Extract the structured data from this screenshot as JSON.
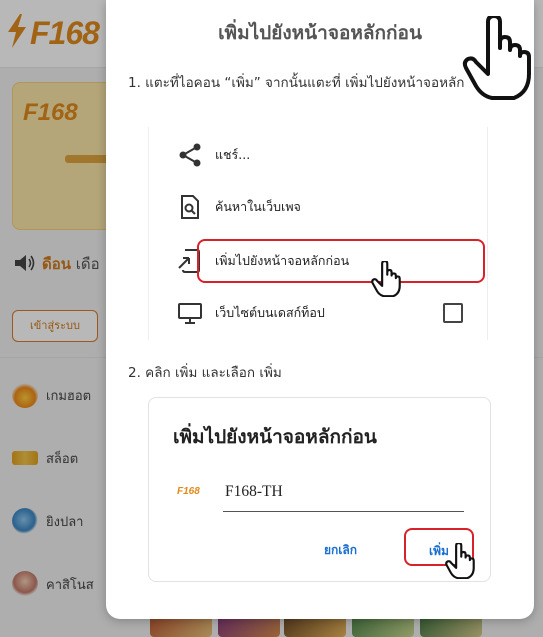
{
  "background": {
    "logo_text": "F168",
    "banner_logo_text": "F168",
    "news_label": "ดือน",
    "news_text": "เดือ",
    "login_button": "เข้าสู่ระบบ",
    "menu": [
      {
        "label": "เกมฮอต",
        "icon": "fire-icon"
      },
      {
        "label": "สล็อต",
        "icon": "slot-777-icon"
      },
      {
        "label": "ยิงปลา",
        "icon": "fish-icon"
      },
      {
        "label": "คาสิโนส",
        "icon": "casino-dealer-icon"
      }
    ]
  },
  "popup": {
    "title": "เพิ่มไปยังหน้าจอหลักก่อน",
    "step1_text": "1. แตะที่ไอคอน “เพิ่ม” จากนั้นแตะที่ เพิ่มไปยังหน้าจอหลัก",
    "step1_menu": [
      {
        "label": "แชร์...",
        "icon": "share-icon"
      },
      {
        "label": "ค้นหาในเว็บเพจ",
        "icon": "find-in-page-icon"
      },
      {
        "label": "เพิ่มไปยังหน้าจอหลักก่อน",
        "icon": "add-to-home-screen-icon"
      },
      {
        "label": "เว็บไซต์บนเดสก์ท็อป",
        "icon": "desktop-icon"
      }
    ],
    "step2_text": "2. คลิก เพิ่ม และเลือก เพิ่ม",
    "dialog": {
      "title": "เพิ่มไปยังหน้าจอหลักก่อน",
      "app_icon_text": "F168",
      "app_name": "F168-TH",
      "cancel_label": "ยกเลิก",
      "add_label": "เพิ่ม"
    }
  },
  "colors": {
    "brand_orange": "#e08a1c",
    "highlight_red": "#d8222a",
    "dialog_blue": "#1a6fd1"
  }
}
